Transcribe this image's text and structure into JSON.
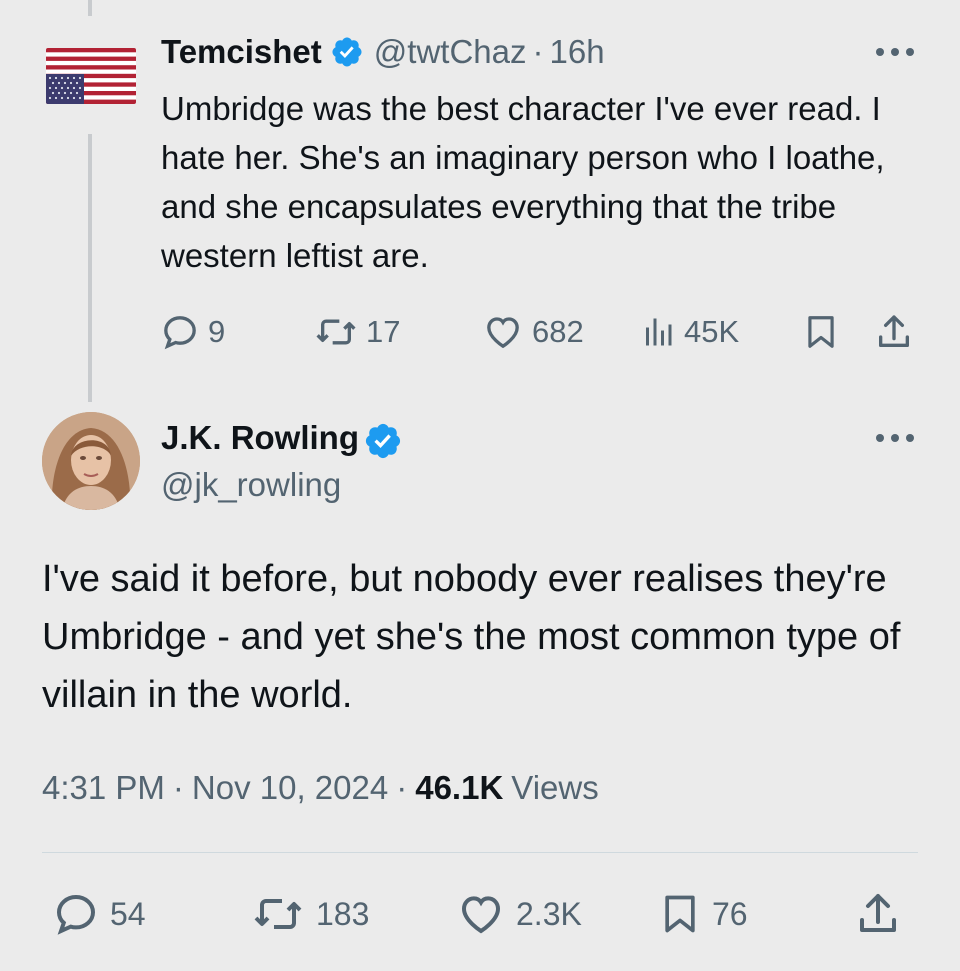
{
  "quoted_tweet": {
    "author_name": "Temcishet",
    "handle": "@twtChaz",
    "separator": "·",
    "time": "16h",
    "text": "Umbridge was the best character I've ever read. I hate her. She's an imaginary person who I loathe, and she encapsulates everything that the tribe western leftist are.",
    "stats": {
      "replies": "9",
      "reposts": "17",
      "likes": "682",
      "views": "45K"
    },
    "avatar_icon": "us-flag-upside-down",
    "verified": true
  },
  "main_tweet": {
    "author_name": "J.K. Rowling",
    "handle": "@jk_rowling",
    "verified": true,
    "text": "I've said it before, but nobody ever realises they're Umbridge - and yet she's the most common type of villain in the world.",
    "time": "4:31 PM",
    "separator": "·",
    "date": "Nov 10, 2024",
    "views_count": "46.1K",
    "views_label": "Views",
    "stats": {
      "replies": "54",
      "reposts": "183",
      "likes": "2.3K",
      "bookmarks": "76"
    }
  },
  "colors": {
    "background": "#ebebeb",
    "verified_blue": "#1d9bf0",
    "muted_text": "#536471",
    "primary_text": "#0f1419"
  }
}
